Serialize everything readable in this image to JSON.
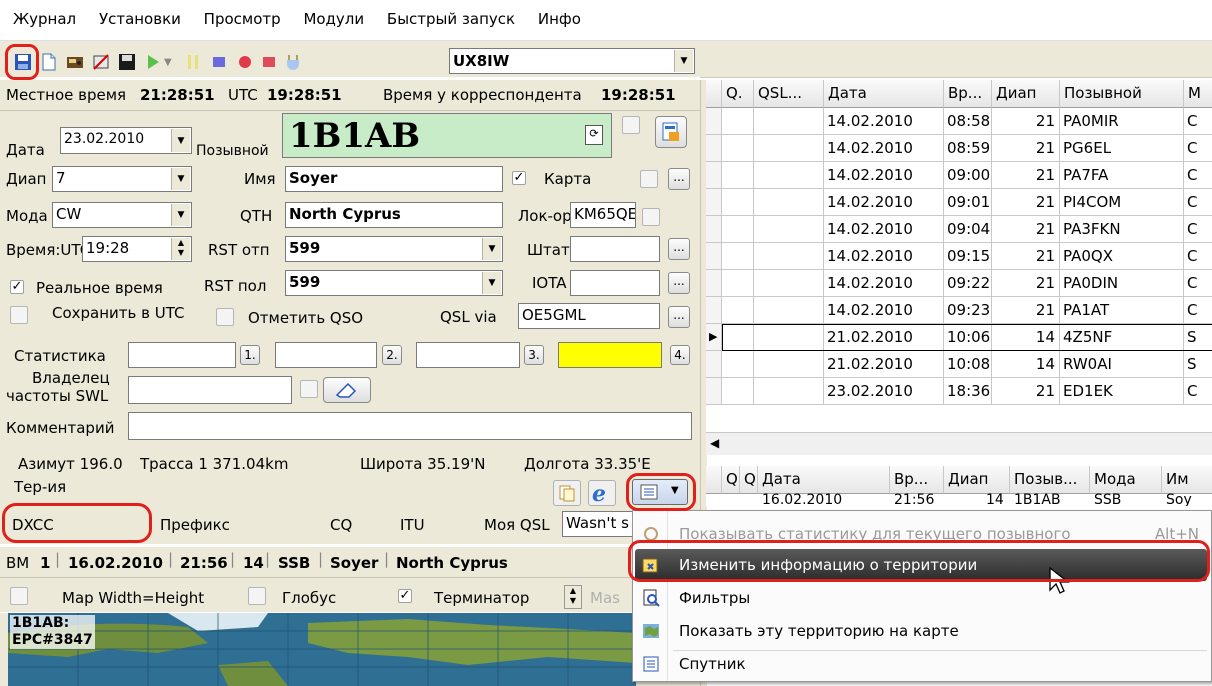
{
  "menubar": [
    "Журнал",
    "Установки",
    "Просмотр",
    "Модули",
    "Быстрый запуск",
    "Инфо"
  ],
  "toolbar": {
    "callsign_select": "UX8IW"
  },
  "timebar": {
    "local_label": "Местное время",
    "local_value": "21:28:51",
    "utc_label": "UTC",
    "utc_value": "19:28:51",
    "corr_label": "Время у корреспондента",
    "corr_value": "19:28:51"
  },
  "form": {
    "date_label": "Дата",
    "date_value": "23.02.2010",
    "callsign_label": "Позывной",
    "callsign_value": "1B1AB",
    "band_label": "Диап",
    "band_value": "7",
    "name_label": "Имя",
    "name_value": "Soyer",
    "map_label": "Карта",
    "mode_label": "Мода",
    "mode_value": "CW",
    "qth_label": "QTH",
    "qth_value": "North Cyprus",
    "locator_label": "Лок-ор",
    "locator_value": "KM65QE",
    "time_label": "Время:UTC",
    "time_value": "19:28",
    "rst_sent_label": "RST отп",
    "rst_sent_value": "599",
    "state_label": "Штат",
    "realtime_label": "Реальное время",
    "rst_rcvd_label": "RST пол",
    "rst_rcvd_value": "599",
    "iota_label": "IOTA",
    "save_utc_label": "Сохранить в UTC",
    "mark_qso_label": "Отметить QSO",
    "qslvia_label": "QSL via",
    "qslvia_value": "OE5GML",
    "stats_label": "Статистика",
    "stat_buttons": [
      "1.",
      "2.",
      "3.",
      "4."
    ],
    "owner_label_1": "Владелец",
    "owner_label_2": "частоты SWL",
    "comment_label": "Комментарий"
  },
  "info": {
    "azimuth": "Азимут 196.0",
    "path": "Трасса  1 371.04km",
    "lat": "Широта 35.19'N",
    "lon": "Долгота 33.35'E",
    "territory_label": "Тер-ия",
    "dxcc_label": "DXCC",
    "prefix_label": "Префикс",
    "cq_label": "CQ",
    "itu_label": "ITU",
    "myqsl_label": "Моя QSL",
    "myqsl_value": "Wasn't s"
  },
  "prev_qso": {
    "mark": "ВМ",
    "num": "1",
    "date": "16.02.2010",
    "time": "21:56",
    "band": "14",
    "mode": "SSB",
    "name": "Soyer",
    "qth": "North Cyprus"
  },
  "map_options": {
    "width_height_label": "Map Width=Height",
    "globe_label": "Глобус",
    "terminator_label": "Терминатор",
    "partial": "Mas"
  },
  "map": {
    "label_line1": "1B1AB:",
    "label_line2": "EPC#3847"
  },
  "log_table": {
    "headers": [
      "Q.",
      "QSL...",
      "Дата",
      "Вр...",
      "Диап",
      "Позывной",
      "M"
    ],
    "rows": [
      {
        "date": "14.02.2010",
        "time": "08:58",
        "band": "21",
        "call": "PA0MIR",
        "extra": "C"
      },
      {
        "date": "14.02.2010",
        "time": "08:59",
        "band": "21",
        "call": "PG6EL",
        "extra": "C"
      },
      {
        "date": "14.02.2010",
        "time": "09:00",
        "band": "21",
        "call": "PA7FA",
        "extra": "C"
      },
      {
        "date": "14.02.2010",
        "time": "09:01",
        "band": "21",
        "call": "PI4COM",
        "extra": "C"
      },
      {
        "date": "14.02.2010",
        "time": "09:04",
        "band": "21",
        "call": "PA3FKN",
        "extra": "C"
      },
      {
        "date": "14.02.2010",
        "time": "09:15",
        "band": "21",
        "call": "PA0QX",
        "extra": "C"
      },
      {
        "date": "14.02.2010",
        "time": "09:22",
        "band": "21",
        "call": "PA0DIN",
        "extra": "C"
      },
      {
        "date": "14.02.2010",
        "time": "09:23",
        "band": "21",
        "call": "PA1AT",
        "extra": "C"
      },
      {
        "date": "21.02.2010",
        "time": "10:06",
        "band": "14",
        "call": "4Z5NF",
        "extra": "S"
      },
      {
        "date": "21.02.2010",
        "time": "10:08",
        "band": "14",
        "call": "RW0AI",
        "extra": "S"
      },
      {
        "date": "23.02.2010",
        "time": "18:36",
        "band": "21",
        "call": "ED1EK",
        "extra": "C"
      }
    ]
  },
  "prev_table": {
    "headers": [
      "Q",
      "Q",
      "Дата",
      "Вр...",
      "Диап",
      "Позыв...",
      "Мода",
      "Им"
    ],
    "row": {
      "date": "16.02.2010",
      "time": "21:56",
      "band": "14",
      "call": "1B1AB",
      "mode": "SSB",
      "name": "Soy"
    }
  },
  "context_menu": {
    "items": [
      {
        "label": "Показывать статистику для текущего позывного",
        "shortcut": "Alt+N",
        "disabled": true
      },
      {
        "label": "Изменить информацию о территории",
        "highlighted": true
      },
      {
        "label": "Фильтры"
      },
      {
        "label": "Показать эту территорию на карте"
      },
      {
        "label": "Спутник"
      }
    ]
  }
}
